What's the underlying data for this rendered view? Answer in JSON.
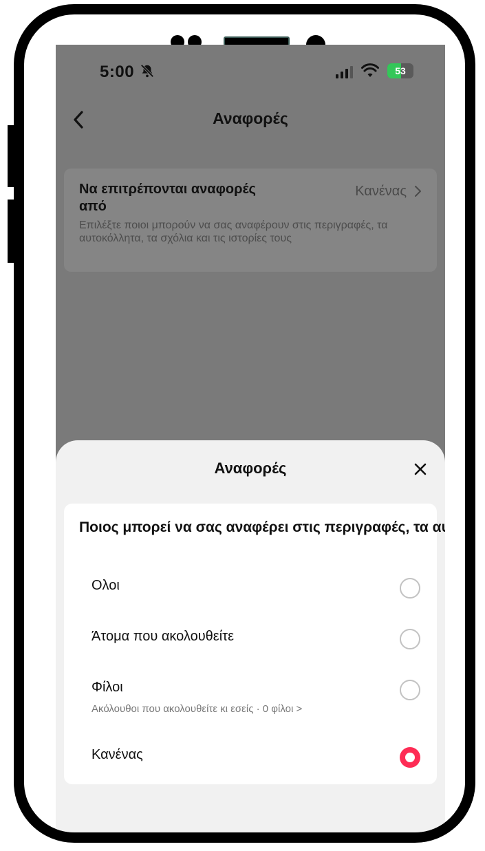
{
  "status_bar": {
    "time": "5:00",
    "battery_level": "53",
    "icons": [
      "bell-slash-icon",
      "signal-icon",
      "wifi-icon",
      "battery-icon"
    ]
  },
  "nav": {
    "back_icon": "chevron-left-icon",
    "title": "Αναφορές"
  },
  "setting": {
    "title": "Να επιτρέπονται αναφορές από",
    "value": "Κανένας",
    "description": "Επιλέξτε ποιοι μπορούν να σας αναφέρουν στις περιγραφές, τα αυτοκόλλητα, τα σχόλια και τις ιστορίες τους"
  },
  "sheet": {
    "title": "Αναφορές",
    "close_icon": "close-icon",
    "question": "Ποιος μπορεί να σας αναφέρει στις περιγραφές, τα αυτοκόλλητα, τα σχόλια κ...",
    "options": [
      {
        "label": "Ολοι",
        "sublabel": "",
        "selected": false
      },
      {
        "label": "Άτομα που ακολουθείτε",
        "sublabel": "",
        "selected": false
      },
      {
        "label": "Φίλοι",
        "sublabel": "Ακόλουθοι που ακολουθείτε κι εσείς · 0 φίλοι >",
        "selected": false
      },
      {
        "label": "Κανένας",
        "sublabel": "",
        "selected": true
      }
    ]
  },
  "colors": {
    "accent": "#fe2c55",
    "battery_green": "#34c759",
    "overlay_gray": "#7a7a7a"
  }
}
